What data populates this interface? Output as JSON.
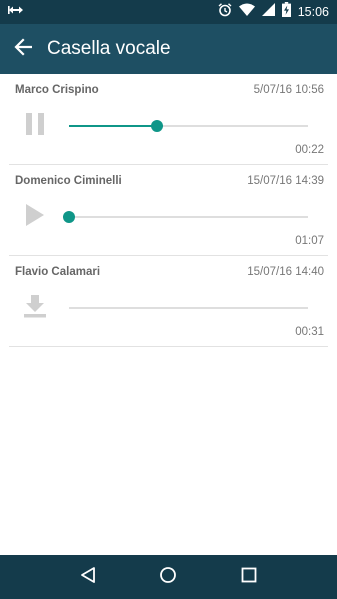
{
  "status_bar": {
    "time": "15:06",
    "icons": [
      "expand-icon",
      "alarm-icon",
      "wifi-icon",
      "signal-icon",
      "battery-charging-icon"
    ]
  },
  "app_bar": {
    "title": "Casella vocale",
    "back_icon": "arrow-left-icon"
  },
  "messages": [
    {
      "name": "Marco Crispino",
      "date": "5/07/16 10:56",
      "duration": "00:22",
      "state": "playing",
      "control_icon": "pause-icon",
      "progress": 0.37,
      "show_thumb": true
    },
    {
      "name": "Domenico Ciminelli",
      "date": "15/07/16 14:39",
      "duration": "01:07",
      "state": "stopped",
      "control_icon": "play-icon",
      "progress": 0.0,
      "show_thumb": true
    },
    {
      "name": "Flavio Calamari",
      "date": "15/07/16 14:40",
      "duration": "00:31",
      "state": "not-downloaded",
      "control_icon": "download-icon",
      "progress": 0.0,
      "show_thumb": false
    }
  ],
  "nav_bar": {
    "icons": [
      "back-triangle-icon",
      "home-circle-icon",
      "recents-square-icon"
    ]
  },
  "colors": {
    "status_bar": "#143b4b",
    "app_bar": "#1e4f63",
    "accent": "#0f9688",
    "track": "#dedede",
    "icon_gray": "#cfcfcf"
  }
}
